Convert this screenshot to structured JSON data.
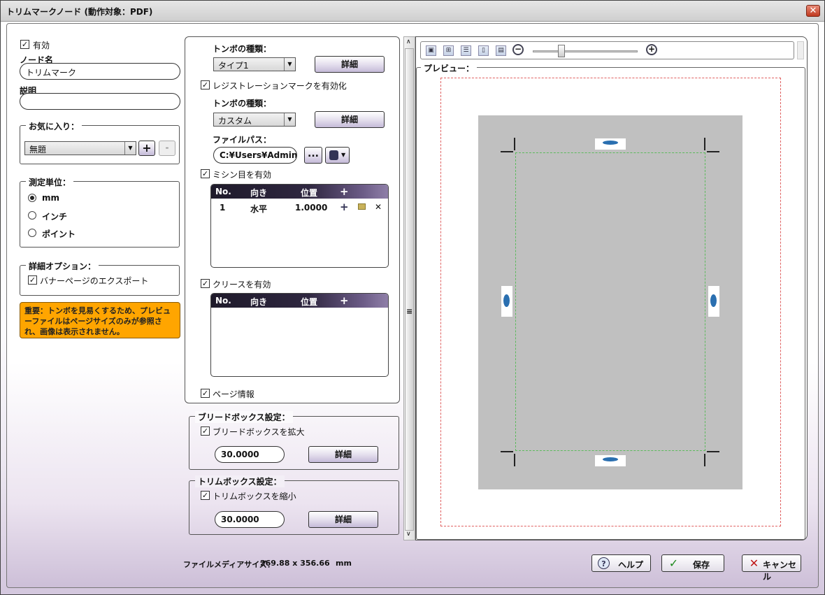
{
  "window": {
    "title": "トリムマークノード (動作対象：PDF)",
    "close_label": "✕"
  },
  "left": {
    "enabled_label": "有効",
    "node_name_label": "ノード名",
    "node_name_value": "トリムマーク",
    "description_label": "説明",
    "description_value": "",
    "favorites_label": "お気に入り：",
    "favorites_value": "無題",
    "add_label": "+",
    "remove_label": "-",
    "units_label": "測定単位：",
    "units": [
      "mm",
      "インチ",
      "ポイント"
    ],
    "advanced_label": "詳細オプション：",
    "banner_export_label": "バナーページのエクスポート",
    "warning": "重要：トンボを見易くするため、プレビューファイルはページサイズのみが参照され、画像は表示されません。",
    "warning_color": "#ffa500"
  },
  "middle": {
    "crop_type_label": "トンボの種類：",
    "crop_type_value": "タイプ1",
    "detail_label": "詳細",
    "registration_label": "レジストレーションマークを有効化",
    "reg_type_label": "トンボの種類：",
    "reg_type_value": "カスタム",
    "file_path_label": "ファイルパス：",
    "file_path_value": "C:¥Users¥Adminis",
    "browse_label": "...",
    "perforation_label": "ミシン目を有効",
    "grid_headers": [
      "No.",
      "向き",
      "位置",
      "+"
    ],
    "perforation_rows": [
      {
        "no": "1",
        "dir": "水平",
        "pos": "1.0000"
      }
    ],
    "crease_label": "クリースを有効",
    "page_info_label": "ページ情報"
  },
  "bleed": {
    "group_label": "ブリードボックス設定：",
    "expand_label": "ブリードボックスを拡大",
    "value": "30.0000",
    "detail_label": "詳細"
  },
  "trim": {
    "group_label": "トリムボックス設定：",
    "shrink_label": "トリムボックスを縮小",
    "value": "30.0000",
    "detail_label": "詳細"
  },
  "preview": {
    "label": "プレビュー："
  },
  "footer": {
    "media_size_label": "ファイルメディアサイズ：",
    "media_size_value": "269.88 x 356.66",
    "media_size_unit": "mm",
    "help_label": "ヘルプ",
    "save_label": "保存",
    "cancel_label": "キャンセル"
  },
  "icons": {
    "check": "✓",
    "dropdown": "▼",
    "zoom_out": "−",
    "zoom_in": "+"
  }
}
